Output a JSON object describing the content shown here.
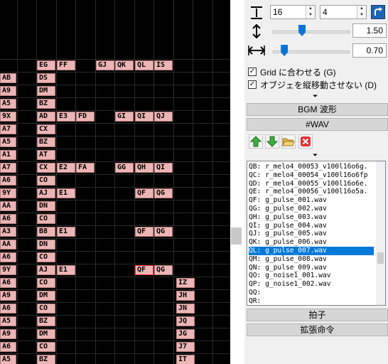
{
  "grid": {
    "columns": [
      "EG",
      "FF",
      "GJ",
      "QK",
      "QL",
      "IS",
      "IZ",
      "JH",
      "JN",
      "JQ",
      "JG",
      "J7",
      "IT"
    ],
    "rows": [
      {
        "cells": [
          [
            0,
            "EG"
          ],
          [
            1,
            "FF"
          ],
          [
            3,
            "GJ"
          ],
          [
            4,
            "QK"
          ],
          [
            5,
            "QL"
          ],
          [
            6,
            "IS"
          ]
        ]
      },
      {
        "cells": [
          [
            -1,
            "AB"
          ],
          [
            0,
            "DS"
          ]
        ]
      },
      {
        "cells": [
          [
            -1,
            "A9"
          ],
          [
            0,
            "DM"
          ]
        ]
      },
      {
        "cells": [
          [
            -1,
            "A5"
          ],
          [
            0,
            "BZ"
          ]
        ]
      },
      {
        "cells": [
          [
            -1,
            "9X"
          ],
          [
            0,
            "AD"
          ],
          [
            1,
            "E3"
          ],
          [
            2,
            "FD"
          ],
          [
            4,
            "GI"
          ],
          [
            5,
            "QI"
          ],
          [
            6,
            "QJ"
          ]
        ]
      },
      {
        "cells": [
          [
            -1,
            "A7"
          ],
          [
            0,
            "CX"
          ]
        ]
      },
      {
        "cells": [
          [
            -1,
            "A5"
          ],
          [
            0,
            "BZ"
          ]
        ]
      },
      {
        "cells": [
          [
            -1,
            "A1"
          ],
          [
            0,
            "AT"
          ]
        ]
      },
      {
        "cells": [
          [
            -1,
            "A7"
          ],
          [
            0,
            "CX"
          ],
          [
            1,
            "E2"
          ],
          [
            2,
            "FA"
          ],
          [
            4,
            "GG"
          ],
          [
            5,
            "QH"
          ],
          [
            6,
            "QI"
          ]
        ]
      },
      {
        "cells": [
          [
            -1,
            "A6"
          ],
          [
            0,
            "CO"
          ]
        ]
      },
      {
        "cells": [
          [
            -1,
            "9Y"
          ],
          [
            0,
            "AJ"
          ],
          [
            1,
            "E1"
          ],
          [
            5,
            "QF"
          ],
          [
            6,
            "QG"
          ]
        ]
      },
      {
        "cells": [
          [
            -1,
            "AA"
          ],
          [
            0,
            "DN"
          ]
        ]
      },
      {
        "cells": [
          [
            -1,
            "A6"
          ],
          [
            0,
            "CO"
          ]
        ]
      },
      {
        "cells": [
          [
            -1,
            "A3"
          ],
          [
            0,
            "B8"
          ],
          [
            1,
            "E1"
          ],
          [
            5,
            "QF"
          ],
          [
            6,
            "QG"
          ]
        ]
      },
      {
        "cells": [
          [
            -1,
            "AA"
          ],
          [
            0,
            "DN"
          ]
        ]
      },
      {
        "cells": [
          [
            -1,
            "A6"
          ],
          [
            0,
            "CO"
          ]
        ]
      },
      {
        "cells": [
          [
            -1,
            "9Y"
          ],
          [
            0,
            "AJ"
          ],
          [
            1,
            "E1"
          ],
          [
            5,
            "QF"
          ],
          [
            6,
            "QG"
          ]
        ]
      },
      {
        "cells": [
          [
            -1,
            "A6"
          ],
          [
            0,
            "CO"
          ],
          [
            8,
            "IZ"
          ]
        ]
      },
      {
        "cells": [
          [
            -1,
            "A9"
          ],
          [
            0,
            "DM"
          ],
          [
            8,
            "JH"
          ]
        ]
      },
      {
        "cells": [
          [
            -1,
            "A6"
          ],
          [
            0,
            "CO"
          ],
          [
            8,
            "JN"
          ]
        ]
      },
      {
        "cells": [
          [
            -1,
            "A5"
          ],
          [
            0,
            "BZ"
          ],
          [
            8,
            "JQ"
          ]
        ]
      },
      {
        "cells": [
          [
            -1,
            "A9"
          ],
          [
            0,
            "DM"
          ],
          [
            8,
            "JG"
          ]
        ]
      },
      {
        "cells": [
          [
            -1,
            "A6"
          ],
          [
            0,
            "CO"
          ],
          [
            8,
            "J7"
          ]
        ]
      },
      {
        "cells": [
          [
            -1,
            "A5"
          ],
          [
            0,
            "BZ"
          ],
          [
            8,
            "IT"
          ]
        ]
      }
    ],
    "selected_note": {
      "row": 16,
      "col": 5
    }
  },
  "controls": {
    "spin1_value": "16",
    "spin2_value": "4",
    "slider_v_value": "1.50",
    "slider_h_value": "0.70",
    "slider_v_level": 0.38,
    "slider_h_level": 0.15,
    "grid_snap_label": "Grid に合わせる (G)",
    "no_vertical_move_label": "オブジェを縦移動させない (D)",
    "grid_snap_checked": true,
    "no_vertical_move_checked": true
  },
  "sections": {
    "bgm_label": "BGM 波形",
    "wav_label": "#WAV",
    "beat_label": "拍子",
    "ext_label": "拡張命令"
  },
  "toolbar": {
    "up_icon": "green-up-arrow-icon",
    "down_icon": "green-down-arrow-icon",
    "folder_icon": "folder-open-icon",
    "delete_icon": "red-x-delete-icon",
    "accent": "#0078d7"
  },
  "wav_list": [
    "QB: r_melo4_00053_v100l16o6g.",
    "QC: r_melo4_00054_v100l16o6fp",
    "QD: r_melo4_00055_v100l16o6e.",
    "QE: r_melo4_00056_v100l16o5a.",
    "QF: g_pulse_001.wav",
    "QG: g_pulse_002.wav",
    "QH: g_pulse_003.wav",
    "QI: g_pulse_004.wav",
    "QJ: g_pulse_005.wav",
    "QK: g_pulse_006.wav",
    "QL: g_pulse_007.wav",
    "QM: g_pulse_008.wav",
    "QN: g_pulse_009.wav",
    "QO: g_noise1_001.wav",
    "QP: g_noise1_002.wav",
    "QQ:",
    "QR:"
  ],
  "wav_selected_index": 10
}
